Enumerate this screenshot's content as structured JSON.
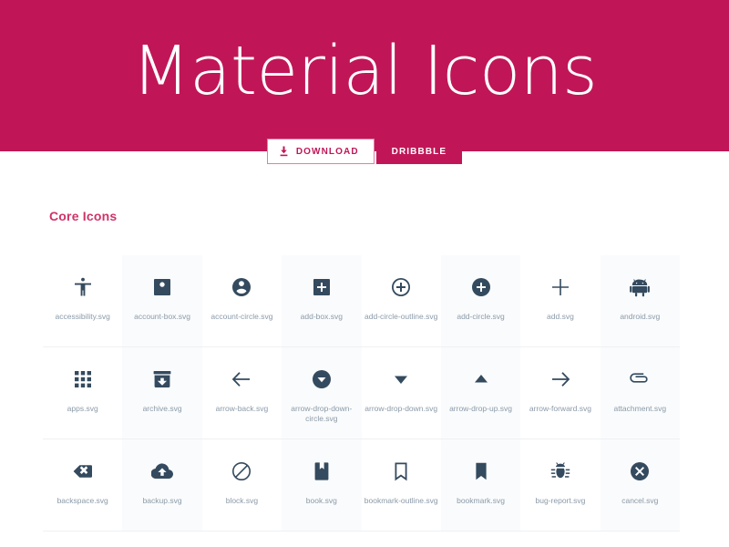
{
  "hero": {
    "title": "Material Icons",
    "background_color": "#c01657"
  },
  "buttons": {
    "download": {
      "label": "DOWNLOAD",
      "icon": "download-icon",
      "text_color": "#c01657",
      "background_color": "#ffffff"
    },
    "dribbble": {
      "label": "DRIBBBLE",
      "text_color": "#ffffff",
      "background_color": "#c01657"
    }
  },
  "section": {
    "title": "Core Icons",
    "title_color": "#cf3368"
  },
  "grid": {
    "icon_color": "#344a5e",
    "label_color": "#8b9aa8",
    "alt_cell_background": "#fafbfc",
    "columns": 8,
    "rows": [
      [
        {
          "label": "accessibility.svg",
          "icon": "accessibility-icon"
        },
        {
          "label": "account-box.svg",
          "icon": "account-box-icon"
        },
        {
          "label": "account-circle.svg",
          "icon": "account-circle-icon"
        },
        {
          "label": "add-box.svg",
          "icon": "add-box-icon"
        },
        {
          "label": "add-circle-outline.svg",
          "icon": "add-circle-outline-icon"
        },
        {
          "label": "add-circle.svg",
          "icon": "add-circle-icon"
        },
        {
          "label": "add.svg",
          "icon": "add-icon"
        },
        {
          "label": "android.svg",
          "icon": "android-icon"
        }
      ],
      [
        {
          "label": "apps.svg",
          "icon": "apps-icon"
        },
        {
          "label": "archive.svg",
          "icon": "archive-icon"
        },
        {
          "label": "arrow-back.svg",
          "icon": "arrow-back-icon"
        },
        {
          "label": "arrow-drop-down-circle.svg",
          "icon": "arrow-drop-down-circle-icon"
        },
        {
          "label": "arrow-drop-down.svg",
          "icon": "arrow-drop-down-icon"
        },
        {
          "label": "arrow-drop-up.svg",
          "icon": "arrow-drop-up-icon"
        },
        {
          "label": "arrow-forward.svg",
          "icon": "arrow-forward-icon"
        },
        {
          "label": "attachment.svg",
          "icon": "attachment-icon"
        }
      ],
      [
        {
          "label": "backspace.svg",
          "icon": "backspace-icon"
        },
        {
          "label": "backup.svg",
          "icon": "backup-icon"
        },
        {
          "label": "block.svg",
          "icon": "block-icon"
        },
        {
          "label": "book.svg",
          "icon": "book-icon"
        },
        {
          "label": "bookmark-outline.svg",
          "icon": "bookmark-outline-icon"
        },
        {
          "label": "bookmark.svg",
          "icon": "bookmark-icon"
        },
        {
          "label": "bug-report.svg",
          "icon": "bug-report-icon"
        },
        {
          "label": "cancel.svg",
          "icon": "cancel-icon"
        }
      ]
    ]
  }
}
